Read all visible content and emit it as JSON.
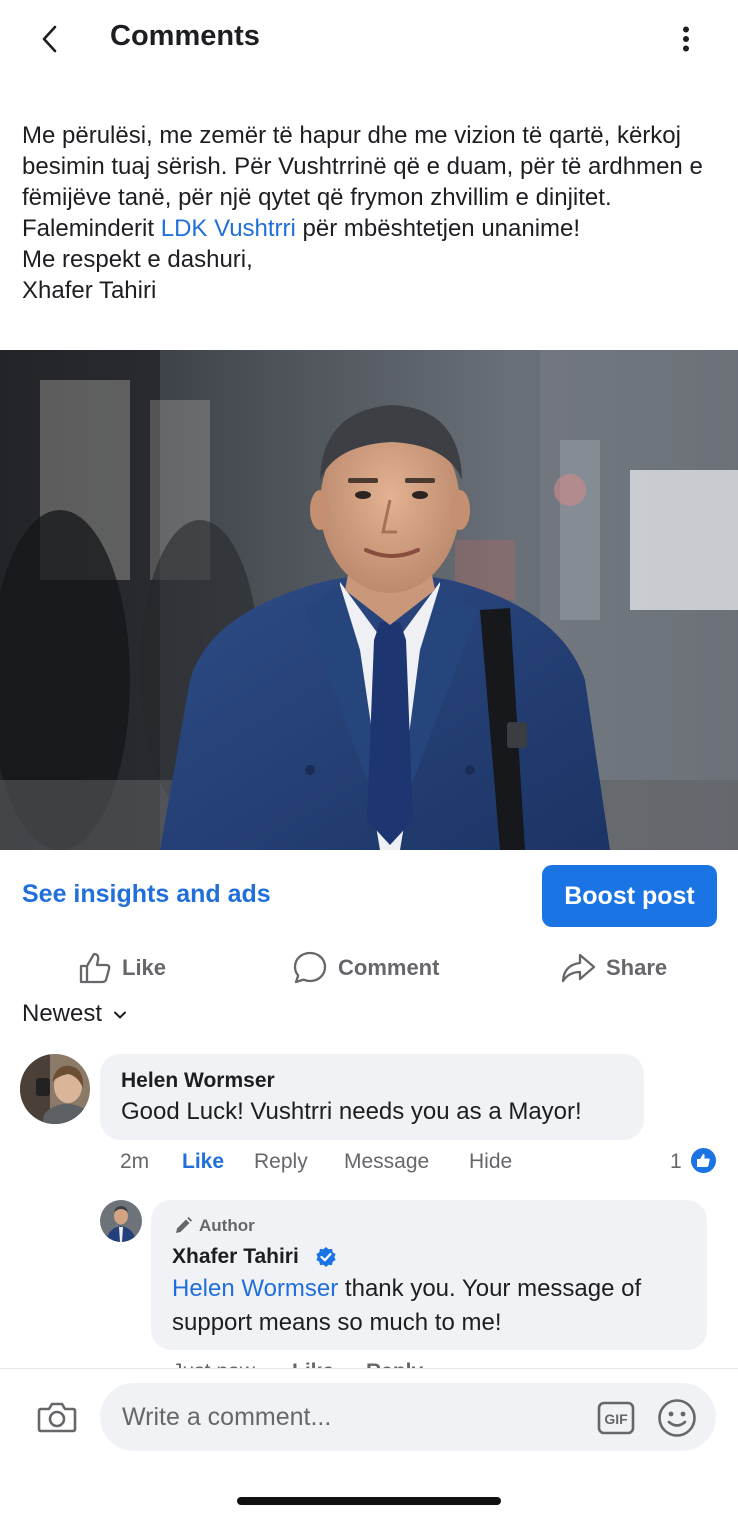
{
  "header": {
    "title": "Comments"
  },
  "post": {
    "paragraphs": [
      "Me përulësi, me zemër të hapur dhe me vizion të qartë, kërkoj besimin tuaj sërish. Për Vushtrrinë që e duam, për të ardhmen e fëmijëve tanë, për një qytet që frymon zhvillim e dinjitet."
    ],
    "thanks_prefix": "Faleminderit ",
    "thanks_mention": "LDK Vushtrri",
    "thanks_suffix": " për mbështetjen unanime!",
    "closing": "Me respekt e dashuri,",
    "signature": "Xhafer Tahiri"
  },
  "insights_link": "See insights and ads",
  "boost_button": "Boost post",
  "actions": {
    "like": "Like",
    "comment": "Comment",
    "share": "Share"
  },
  "sort": {
    "label": "Newest"
  },
  "comments": [
    {
      "name": "Helen Wormser",
      "text": "Good Luck! Vushtrri needs you as a Mayor!",
      "time": "2m",
      "like": "Like",
      "reply": "Reply",
      "message": "Message",
      "hide": "Hide",
      "reaction_count": "1"
    }
  ],
  "reply": {
    "badge": "Author",
    "name": "Xhafer Tahiri",
    "mention": "Helen Wormser",
    "text": " thank you. Your message of support means so much to me!",
    "time": "Just now",
    "like": "Like",
    "reply": "Reply"
  },
  "composer": {
    "placeholder": "Write a comment..."
  },
  "colors": {
    "accent": "#216fdb",
    "boost": "#1b74e4",
    "bubble": "#f0f2f5",
    "muted": "#65676b"
  },
  "icons": [
    "back-chevron-icon",
    "more-vertical-icon",
    "thumbs-up-icon",
    "comment-bubble-icon",
    "share-arrow-icon",
    "chevron-down-icon",
    "like-reaction-icon",
    "pencil-icon",
    "verified-badge-icon",
    "camera-icon",
    "gif-icon",
    "emoji-icon"
  ]
}
